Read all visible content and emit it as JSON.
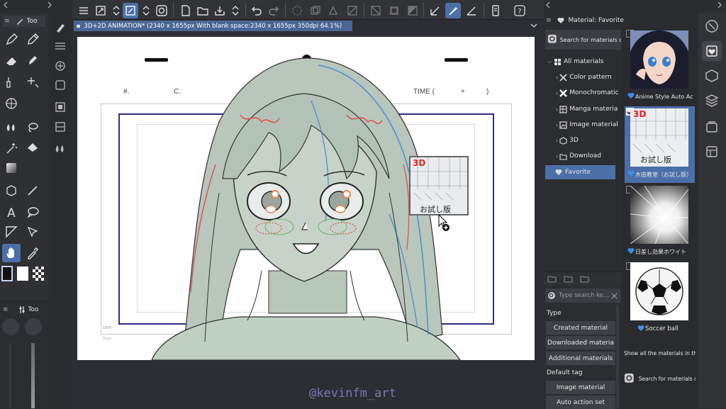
{
  "document": {
    "tab_title": "3D+2D ANIMATION* (2340 x 1655px With blank space:2340 x 1655px 350dpi 64.1%)",
    "sheet_number_label": "#.",
    "sheet_cut_label": "C.",
    "sheet_time_label": "TIME (",
    "sheet_time_plus": "+",
    "sheet_time_close": ")",
    "frame_small_label": "100F",
    "frame_small_label2": "Scan"
  },
  "left_toolbar": {
    "tab_label": "Too",
    "subtool_tab_label": "Too"
  },
  "material_panel": {
    "title": "Material: Favorite",
    "search_label": "Search for materials on A",
    "tree": [
      {
        "label": "All materials"
      },
      {
        "label": "Color pattern"
      },
      {
        "label": "Monochromatic"
      },
      {
        "label": "Manga materia"
      },
      {
        "label": "Image material"
      },
      {
        "label": "3D"
      },
      {
        "label": "Download"
      },
      {
        "label": "Favorite"
      }
    ],
    "tag_search_placeholder": "Type search ke...",
    "type_heading": "Type",
    "type_buttons": [
      "Created material",
      "Downloaded materia",
      "Additional materials"
    ],
    "default_tag_heading": "Default tag",
    "tag_buttons": [
      "Image material",
      "Auto action set"
    ],
    "thumbnails": [
      {
        "caption": "Anime Style Auto Action"
      },
      {
        "caption": "木造教室（お試し版）",
        "badge": "3D",
        "stamp": "お試し版"
      },
      {
        "caption": "日差し効果ホワイト"
      },
      {
        "caption": "Soccer ball"
      }
    ],
    "show_all_label": "Show all the materials in the fol",
    "bottom_search_label": "Search for materials on"
  },
  "drag_preview": {
    "badge": "3D",
    "stamp": "お試し版"
  },
  "watermark": "@kevinfm_art",
  "colors": {
    "accent": "#4b6fa8",
    "favorite_heart": "#3b8fe8",
    "badge_red": "#e0251b"
  }
}
